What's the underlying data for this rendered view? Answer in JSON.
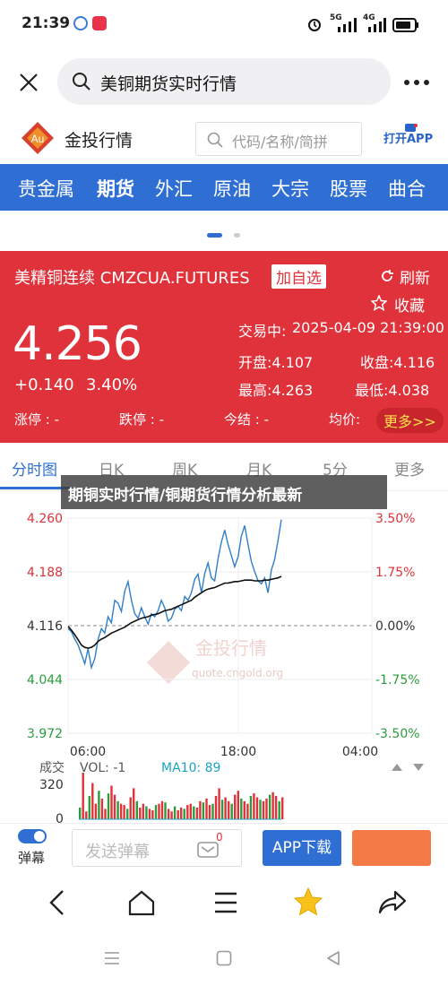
{
  "status": {
    "time": "21:39",
    "network": "5G",
    "network2": "4G"
  },
  "search": {
    "query": "美铜期货实时行情"
  },
  "brand": {
    "name": "金投行情",
    "logo_text": "Au",
    "code_placeholder": "代码/名称/简拼",
    "open_app": "打开APP"
  },
  "categories": [
    "贵金属",
    "期货",
    "外汇",
    "原油",
    "大宗",
    "股票",
    "曲合"
  ],
  "active_category": "期货",
  "quote": {
    "name": "美精铜连续 CMZCUA.FUTURES",
    "add_label": "加自选",
    "refresh_label": "刷新",
    "fav_label": "收藏",
    "price": "4.256",
    "change": "+0.140",
    "change_pct": "3.40%",
    "trade_time_label": "交易中:",
    "trade_time": "2025-04-09 21:39:00",
    "open": "开盘:4.107",
    "prev_close": "收盘:4.116",
    "high": "最高:4.263",
    "low": "最低:4.038",
    "limit_up": "涨停 : -",
    "limit_down": "跌停 : -",
    "settle": "今结 : -",
    "avg": "均价:",
    "more": "更多>>"
  },
  "tabs": [
    "分时图",
    "日K",
    "周K",
    "月K",
    "5分",
    "更多"
  ],
  "banner": "期铜实时行情/铜期货行情分析最新",
  "chart_data": {
    "type": "line",
    "y_left_ticks": [
      "4.260",
      "4.188",
      "4.116",
      "4.044",
      "3.972"
    ],
    "y_right_ticks": [
      "3.50%",
      "1.75%",
      "0.00%",
      "-1.75%",
      "-3.50%"
    ],
    "x_ticks": [
      "06:00",
      "18:00",
      "04:00"
    ],
    "ylim": [
      3.972,
      4.26
    ],
    "reference": 4.116,
    "watermark": "金投行情",
    "watermark_url": "quote.cngold.org",
    "volume_label": "成交",
    "vol_text": "VOL: -1",
    "ma_text": "MA10: 89",
    "volume_ticks": [
      "320",
      "0"
    ],
    "series": [
      {
        "values": [
          4.112,
          4.108,
          4.098,
          4.09,
          4.078,
          4.065,
          4.085,
          4.06,
          4.072,
          4.098,
          4.112,
          4.106,
          4.128,
          4.12,
          4.15,
          4.146,
          4.135,
          4.162,
          4.175,
          4.15,
          4.132,
          4.126,
          4.14,
          4.128,
          4.118,
          4.132,
          4.128,
          4.136,
          4.15,
          4.14,
          4.122,
          4.126,
          4.138,
          4.142,
          4.136,
          4.155,
          4.15,
          4.16,
          4.178,
          4.185,
          4.16,
          4.186,
          4.2,
          4.18,
          4.176,
          4.205,
          4.228,
          4.244,
          4.225,
          4.21,
          4.195,
          4.208,
          4.236,
          4.25,
          4.225,
          4.202,
          4.188,
          4.176,
          4.172,
          4.18,
          4.16,
          4.19,
          4.205,
          4.23,
          4.258
        ]
      },
      {
        "values": [
          4.115,
          4.11,
          4.104,
          4.097,
          4.09,
          4.087,
          4.086,
          4.087,
          4.09,
          4.095,
          4.098,
          4.1,
          4.103,
          4.106,
          4.108,
          4.11,
          4.112,
          4.114,
          4.117,
          4.12,
          4.122,
          4.124,
          4.126,
          4.127,
          4.128,
          4.13,
          4.131,
          4.132,
          4.134,
          4.136,
          4.137,
          4.138,
          4.14,
          4.142,
          4.144,
          4.146,
          4.148,
          4.15,
          4.154,
          4.157,
          4.16,
          4.163,
          4.165,
          4.166,
          4.167,
          4.169,
          4.171,
          4.173,
          4.173,
          4.174,
          4.175,
          4.175,
          4.176,
          4.177,
          4.177,
          4.177,
          4.176,
          4.176,
          4.176,
          4.177,
          4.177,
          4.178,
          4.179,
          4.18,
          4.182
        ]
      }
    ],
    "volumes": [
      45,
      180,
      30,
      90,
      140,
      60,
      110,
      80,
      40,
      100,
      130,
      95,
      70,
      60,
      55,
      40,
      85,
      120,
      70,
      45,
      60,
      50,
      40,
      35,
      55,
      60,
      70,
      65,
      40,
      30,
      50,
      35,
      45,
      40,
      55,
      60,
      50,
      45,
      70,
      65,
      80,
      55,
      60,
      90,
      120,
      75,
      85,
      70,
      60,
      95,
      110,
      80,
      70,
      60,
      90,
      100,
      85,
      75,
      70,
      80,
      95,
      105,
      90,
      70,
      85
    ]
  },
  "bottom": {
    "danmu_label": "弹幕",
    "danmu_placeholder": "发送弹幕",
    "danmu_count": "0",
    "app_download": "APP下载"
  }
}
